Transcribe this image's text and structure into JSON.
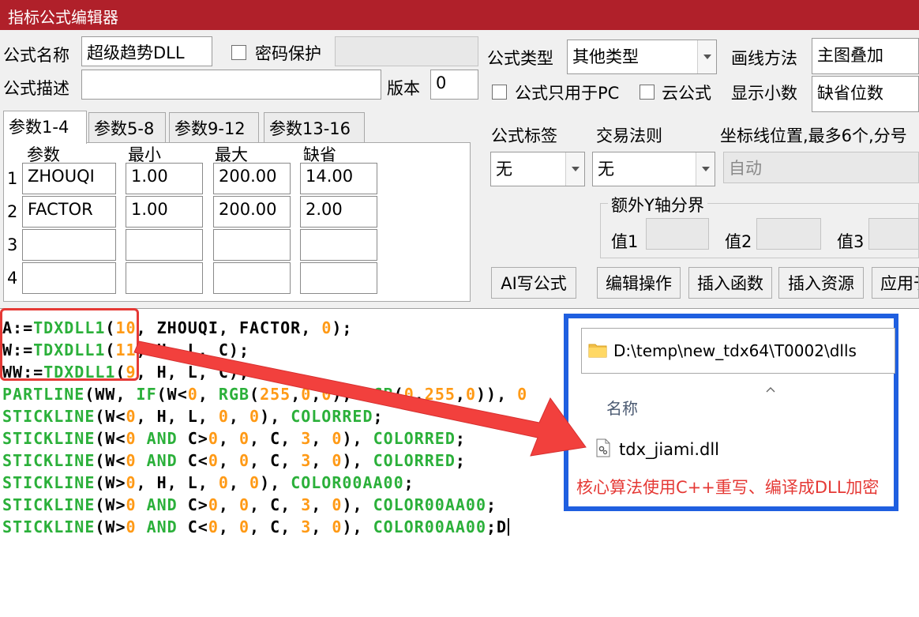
{
  "window": {
    "title": "指标公式编辑器"
  },
  "form": {
    "name_label": "公式名称",
    "name_value": "超级趋势DLL",
    "password_label": "密码保护",
    "desc_label": "公式描述",
    "desc_value": "",
    "version_label": "版本",
    "version_value": "0",
    "type_label": "公式类型",
    "type_value": "其他类型",
    "draw_label": "画线方法",
    "draw_value": "主图叠加",
    "pc_only_label": "公式只用于PC",
    "cloud_label": "云公式",
    "decimal_label": "显示小数",
    "decimal_value": "缺省位数",
    "tag_label": "公式标签",
    "tag_value": "无",
    "rule_label": "交易法则",
    "rule_value": "无",
    "axis_label": "坐标线位置,最多6个,分号",
    "axis_value": "自动",
    "yaxis_group_label": "额外Y轴分界",
    "y1_label": "值1",
    "y2_label": "值2",
    "y3_label": "值3"
  },
  "tabs": [
    "参数1-4",
    "参数5-8",
    "参数9-12",
    "参数13-16"
  ],
  "params": {
    "headers": [
      "参数",
      "最小",
      "最大",
      "缺省"
    ],
    "rows": [
      {
        "idx": "1",
        "name": "ZHOUQI",
        "min": "1.00",
        "max": "200.00",
        "def": "14.00"
      },
      {
        "idx": "2",
        "name": "FACTOR",
        "min": "1.00",
        "max": "200.00",
        "def": "2.00"
      },
      {
        "idx": "3",
        "name": "",
        "min": "",
        "max": "",
        "def": ""
      },
      {
        "idx": "4",
        "name": "",
        "min": "",
        "max": "",
        "def": ""
      }
    ]
  },
  "buttons": {
    "ai": "AI写公式",
    "edit": "编辑操作",
    "insert_func": "插入函数",
    "insert_res": "插入资源",
    "apply": "应用于"
  },
  "code_lines": [
    "A:=TDXDLL1(10, ZHOUQI, FACTOR, 0);",
    "W:=TDXDLL1(11, H, L, C);",
    "WW:=TDXDLL1(9, H, L, C);",
    "PARTLINE(WW, IF(W<0, RGB(255,0,0), RGB(0,255,0)), 0",
    "STICKLINE(W<0, H, L, 0, 0), COLORRED;",
    "STICKLINE(W<0 AND C>0, 0, C, 3, 0), COLORRED;",
    "STICKLINE(W<0 AND C<0, 0, C, 3, 0), COLORRED;",
    "STICKLINE(W>0, H, L, 0, 0), COLOR00AA00;",
    "STICKLINE(W>0 AND C>0, 0, C, 3, 0), COLOR00AA00;",
    "STICKLINE(W>0 AND C<0, 0, C, 3, 0), COLOR00AA00;D"
  ],
  "explorer": {
    "path": "D:\\temp\\new_tdx64\\T0002\\dlls",
    "column_header": "名称",
    "file_name": "tdx_jiami.dll",
    "note": "核心算法使用C++重写、编译成DLL加密"
  },
  "colors": {
    "title_bar": "#b0202a",
    "code_function": "#2bb03a",
    "code_number": "#ff9a16",
    "annotation_red": "#e53935",
    "annotation_blue": "#1f5fe0"
  }
}
